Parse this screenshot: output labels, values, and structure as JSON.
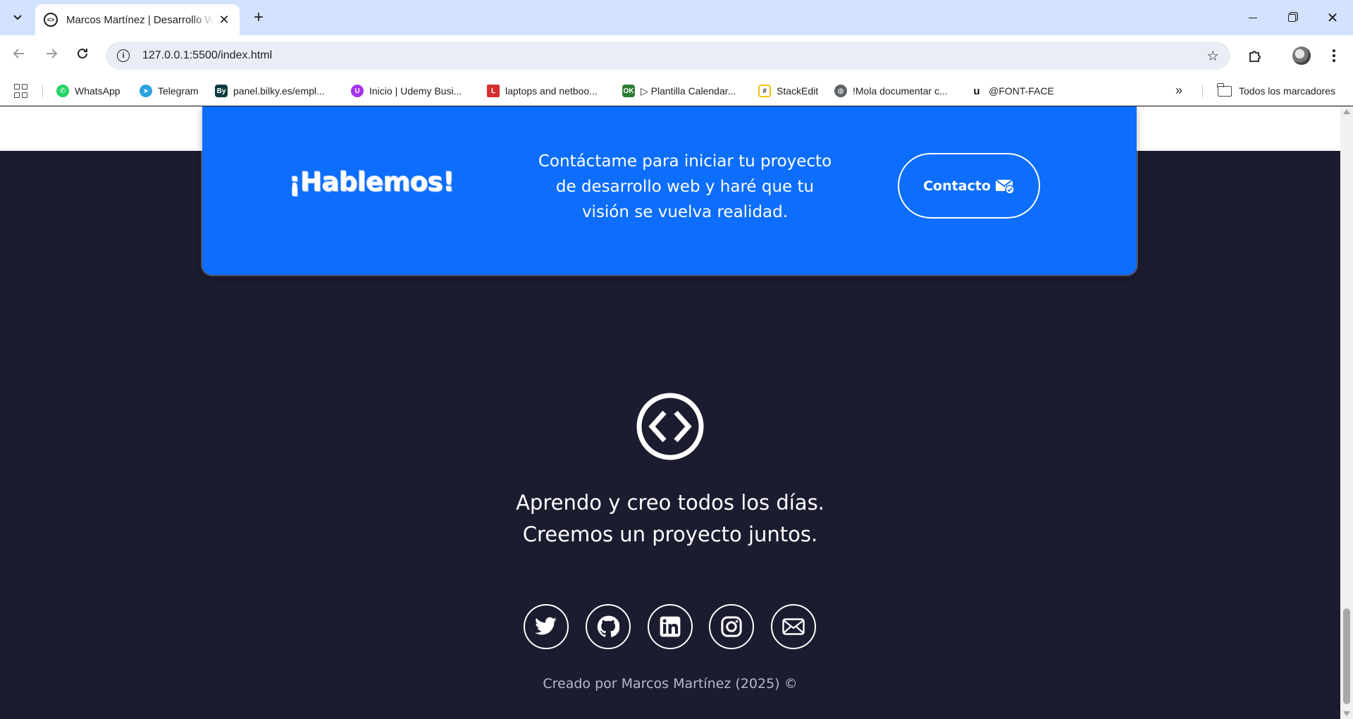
{
  "browser": {
    "tab_title": "Marcos Martínez | Desarrollo Web",
    "url": "127.0.0.1:5500/index.html",
    "bookmarks": [
      {
        "label": "WhatsApp",
        "color": "#25d366"
      },
      {
        "label": "Telegram",
        "color": "#2aa3df"
      },
      {
        "label": "panel.bilky.es/empl...",
        "color": "#0b3b3c"
      },
      {
        "label": "Inicio | Udemy Busi...",
        "color": "#a435f0"
      },
      {
        "label": "laptops and netboo...",
        "color": "#d32f2f"
      },
      {
        "label": "▷ Plantilla Calendar...",
        "color": "#2e7d32"
      },
      {
        "label": "StackEdit",
        "color": "#f4c20d"
      },
      {
        "label": "!Mola documentar c...",
        "color": "#5f6368"
      },
      {
        "label": "@FONT-FACE",
        "color": "#111111"
      }
    ],
    "all_bookmarks_label": "Todos los marcadores"
  },
  "cta": {
    "title": "¡Hablemos!",
    "text": "Contáctame para iniciar tu proyecto de desarrollo web y haré que tu visión se vuelva realidad.",
    "button_label": "Contacto"
  },
  "footer": {
    "tagline_line1": "Aprendo y creo todos los días.",
    "tagline_line2": "Creemos un proyecto juntos.",
    "socials": [
      "twitter-icon",
      "github-icon",
      "linkedin-icon",
      "instagram-icon",
      "email-icon"
    ],
    "credits": "Creado por Marcos Martínez (2025) ©"
  },
  "colors": {
    "accent": "#0d6efd",
    "footer_bg": "#1c1c30"
  }
}
